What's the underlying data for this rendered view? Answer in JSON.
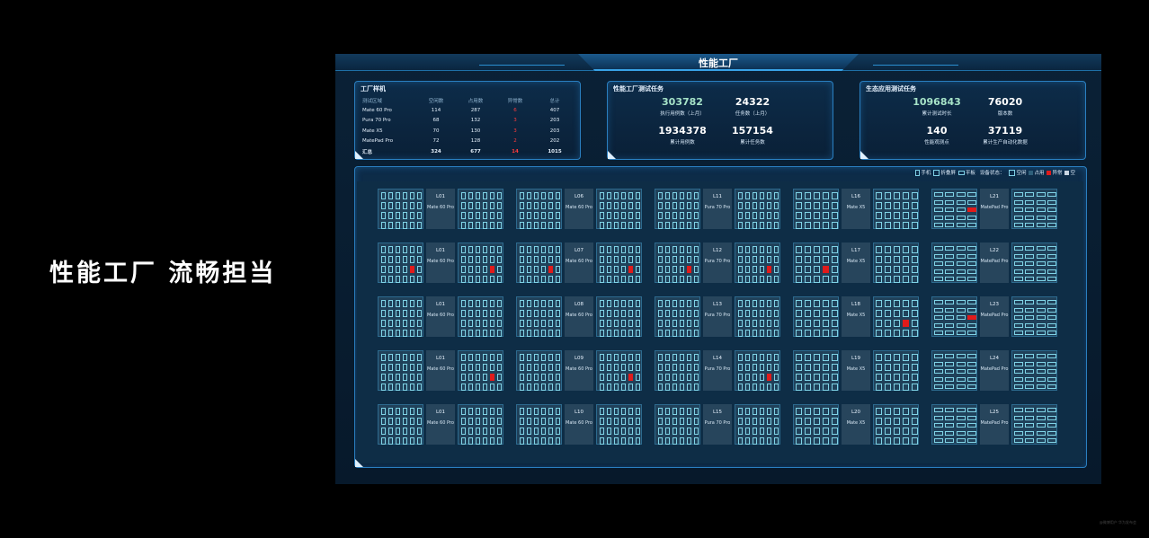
{
  "slogan": "性能工厂 流畅担当",
  "screen_title": "性能工厂",
  "factory_samples": {
    "title": "工厂样机",
    "headers": [
      "测试区域",
      "空闲数",
      "占用数",
      "异常数",
      "总计"
    ],
    "rows": [
      [
        "Mate 60 Pro",
        "114",
        "287",
        "6",
        "407"
      ],
      [
        "Pura 70 Pro",
        "68",
        "132",
        "3",
        "203"
      ],
      [
        "Mate X5",
        "70",
        "130",
        "3",
        "203"
      ],
      [
        "MatePad Pro",
        "72",
        "128",
        "2",
        "202"
      ]
    ],
    "total": [
      "汇总",
      "324",
      "677",
      "14",
      "1015"
    ]
  },
  "perf_tasks": {
    "title": "性能工厂测试任务",
    "stats": [
      {
        "value": "303782",
        "label": "执行用例数（上月）"
      },
      {
        "value": "24322",
        "label": "任务数（上月）"
      },
      {
        "value": "1934378",
        "label": "累计用例数"
      },
      {
        "value": "157154",
        "label": "累计任务数"
      }
    ]
  },
  "eco_tasks": {
    "title": "生态应用测试任务",
    "stats": [
      {
        "value": "1096843",
        "label": "累计测试时长"
      },
      {
        "value": "76020",
        "label": "版本数"
      },
      {
        "value": "140",
        "label": "性能观测点"
      },
      {
        "value": "37119",
        "label": "累计生产自动化数据"
      }
    ]
  },
  "legend": {
    "phone": "手机",
    "fold": "折叠屏",
    "tablet": "平板",
    "status_label": "设备状态：",
    "idle": "空闲",
    "busy": "占用",
    "error": "异常",
    "empty": "空"
  },
  "colors": {
    "accent": "#2a7fc0",
    "error": "#e01b1b",
    "slot": "#7fd3e6",
    "green_value": "#a6e3c8"
  },
  "columns": [
    {
      "kind": "phone",
      "units": [
        {
          "code": "L01",
          "model": "Mate 60 Pro",
          "err": []
        },
        {
          "code": "L01",
          "model": "Mate 60 Pro",
          "err": [
            [
              "l",
              2,
              4
            ],
            [
              "r",
              2,
              4
            ]
          ]
        },
        {
          "code": "L01",
          "model": "Mate 60 Pro",
          "err": []
        },
        {
          "code": "L01",
          "model": "Mate 60 Pro",
          "err": [
            [
              "r",
              2,
              4
            ]
          ]
        },
        {
          "code": "L01",
          "model": "Mate 60 Pro",
          "err": []
        }
      ]
    },
    {
      "kind": "phone",
      "units": [
        {
          "code": "L06",
          "model": "Mate 60 Pro",
          "err": []
        },
        {
          "code": "L07",
          "model": "Mate 60 Pro",
          "err": [
            [
              "l",
              2,
              4
            ],
            [
              "r",
              2,
              4
            ]
          ]
        },
        {
          "code": "L08",
          "model": "Mate 60 Pro",
          "err": []
        },
        {
          "code": "L09",
          "model": "Mate 60 Pro",
          "err": [
            [
              "r",
              2,
              4
            ]
          ]
        },
        {
          "code": "L10",
          "model": "Mate 60 Pro",
          "err": []
        }
      ]
    },
    {
      "kind": "phone",
      "units": [
        {
          "code": "L11",
          "model": "Pura 70 Pro",
          "err": []
        },
        {
          "code": "L12",
          "model": "Pura 70 Pro",
          "err": [
            [
              "l",
              2,
              4
            ],
            [
              "r",
              2,
              4
            ]
          ]
        },
        {
          "code": "L13",
          "model": "Pura 70 Pro",
          "err": []
        },
        {
          "code": "L14",
          "model": "Pura 70 Pro",
          "err": [
            [
              "r",
              2,
              4
            ]
          ]
        },
        {
          "code": "L15",
          "model": "Pura 70 Pro",
          "err": []
        }
      ]
    },
    {
      "kind": "fold",
      "units": [
        {
          "code": "L16",
          "model": "Mate X5",
          "err": []
        },
        {
          "code": "L17",
          "model": "Mate X5",
          "err": [
            [
              "l",
              2,
              3
            ]
          ]
        },
        {
          "code": "L18",
          "model": "Mate X5",
          "err": [
            [
              "r",
              2,
              3
            ]
          ]
        },
        {
          "code": "L19",
          "model": "Mate X5",
          "err": []
        },
        {
          "code": "L20",
          "model": "Mate X5",
          "err": []
        }
      ]
    },
    {
      "kind": "tablet",
      "units": [
        {
          "code": "L21",
          "model": "MatePad Pro",
          "err": [
            [
              "l",
              2,
              3
            ]
          ]
        },
        {
          "code": "L22",
          "model": "MatePad Pro",
          "err": []
        },
        {
          "code": "L23",
          "model": "MatePad Pro",
          "err": [
            [
              "l",
              2,
              3
            ]
          ]
        },
        {
          "code": "L24",
          "model": "MatePad Pro",
          "err": []
        },
        {
          "code": "L25",
          "model": "MatePad Pro",
          "err": []
        }
      ]
    }
  ],
  "watermark": "@微博用户 华为发布会"
}
